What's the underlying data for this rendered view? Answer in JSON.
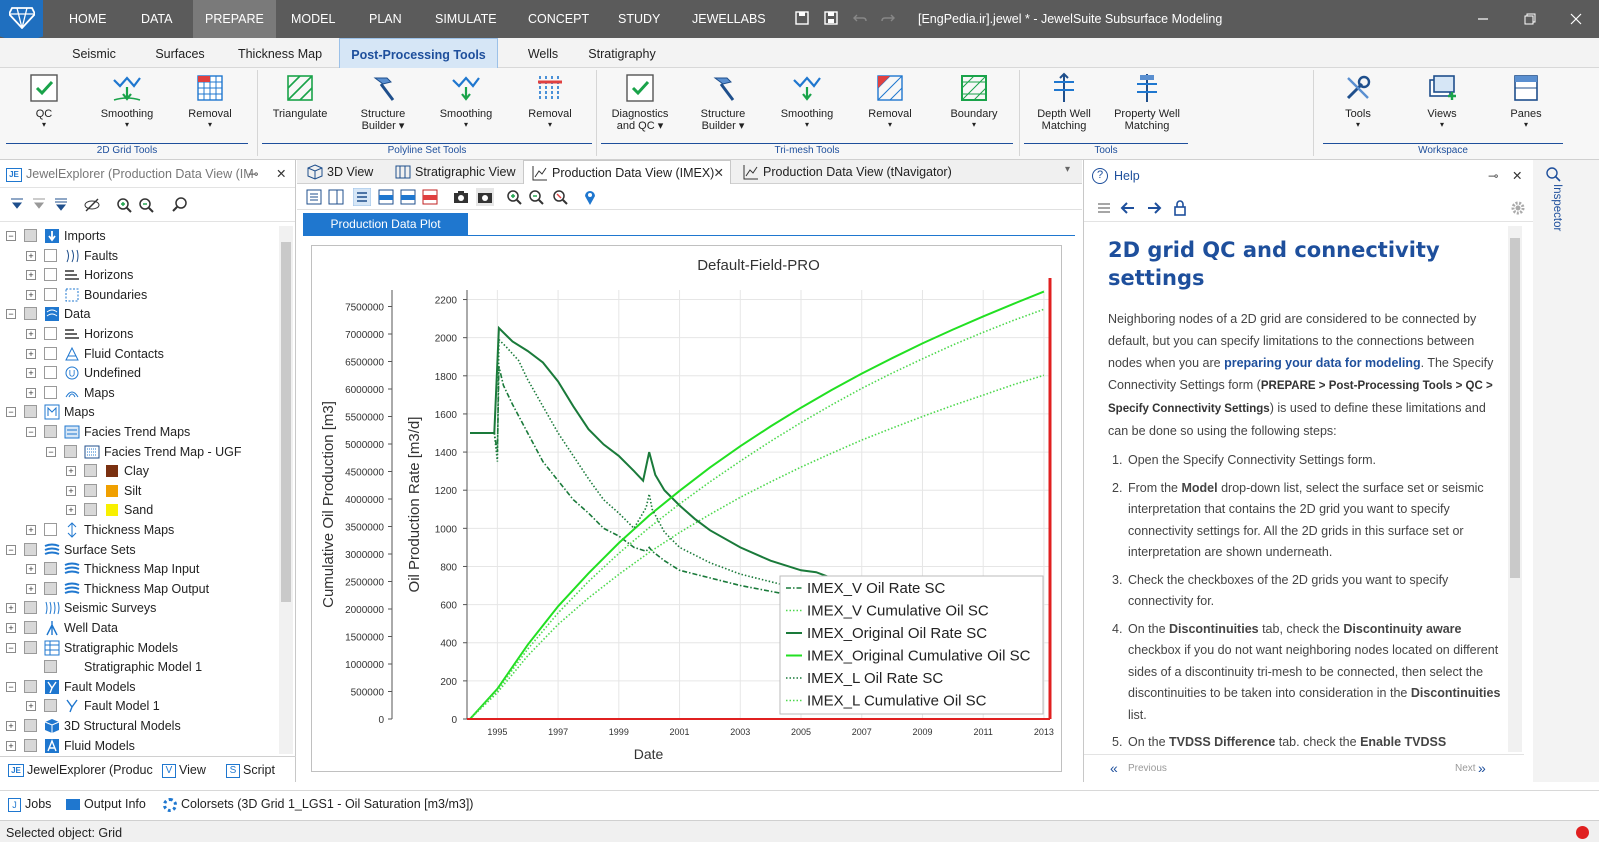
{
  "app": {
    "menu": [
      "HOME",
      "DATA",
      "PREPARE",
      "MODEL",
      "PLAN",
      "SIMULATE",
      "CONCEPT",
      "STUDY",
      "JEWELLABS"
    ],
    "active_menu": "PREPARE",
    "title_file": "[EngPedia.ir].jewel *",
    "title_app": " - JewelSuite Subsurface Modeling",
    "accent": "#1f77cf"
  },
  "subtabs": [
    "Seismic",
    "Surfaces",
    "Thickness Map",
    "Post-Processing Tools",
    "Wells",
    "Stratigraphy"
  ],
  "ribbon": {
    "b1": "QC",
    "b2": "Smoothing",
    "b3": "Removal",
    "g1": "2D Grid Tools",
    "b4": "Triangulate",
    "b5a": "Structure",
    "b5b": "Builder",
    "b6": "Smoothing",
    "b7": "Removal",
    "g2": "Polyline Set Tools",
    "b8a": "Diagnostics",
    "b8b": "and QC",
    "b9a": "Structure",
    "b9b": "Builder",
    "b10": "Smoothing",
    "b11": "Removal",
    "b12": "Boundary",
    "g3": "Tri-mesh Tools",
    "b13a": "Depth Well",
    "b13b": "Matching",
    "b14a": "Property Well",
    "b14b": "Matching",
    "g4": "Tools",
    "b15": "Tools",
    "b16": "Views",
    "b17": "Panes",
    "g5": "Workspace"
  },
  "explorer": {
    "title": "JewelExplorer (Production Data View (IM",
    "tree": [
      "Imports",
      "Faults",
      "Horizons",
      "Boundaries",
      "Data",
      "Horizons",
      "Fluid Contacts",
      "Undefined",
      "Maps",
      "Maps",
      "Facies Trend Maps",
      "Facies Trend Map - UGF",
      "Clay",
      "Silt",
      "Sand",
      "Thickness Maps",
      "Surface Sets",
      "Thickness Map Input",
      "Thickness Map Output",
      "Seismic Surveys",
      "Well Data",
      "Stratigraphic Models",
      "Stratigraphic Model 1",
      "Fault Models",
      "Fault Model 1",
      "3D Structural Models",
      "Fluid Models"
    ],
    "bottom_tabs": [
      "JewelExplorer (Produc",
      "View",
      "Script"
    ],
    "legend_colors": {
      "clay": "#7a3010",
      "silt": "#f0a000",
      "sand": "#f8f000"
    }
  },
  "center": {
    "tabs": [
      "3D View",
      "Stratigraphic View",
      "Production Data View (IMEX)",
      "Production Data View (tNavigator)"
    ],
    "plot_tab": "Production Data Plot"
  },
  "chart_data": {
    "type": "line",
    "title": "Default-Field-PRO",
    "xlabel": "Date",
    "ylabel_left": "Cumulative Oil Production [m3]",
    "ylabel_right": "Oil Production Rate [m3/d]",
    "x_ticks": [
      "1995",
      "1997",
      "1999",
      "2001",
      "2003",
      "2005",
      "2007",
      "2009",
      "2011",
      "2013"
    ],
    "xlim": [
      1994,
      2013.2
    ],
    "ylim_cum": [
      0,
      7800000
    ],
    "ylim_rate": [
      0,
      2250
    ],
    "cum_ticks": [
      "7500000",
      "7000000",
      "6500000",
      "6000000",
      "5500000",
      "5000000",
      "4500000",
      "4000000",
      "3500000",
      "3000000",
      "2500000",
      "2000000",
      "1500000",
      "1000000",
      "500000",
      "0"
    ],
    "rate_ticks": [
      "2200",
      "2000",
      "1800",
      "1600",
      "1400",
      "1200",
      "1000",
      "800",
      "600",
      "400",
      "200",
      "0"
    ],
    "legend_placement": "bottom-right",
    "series": [
      {
        "name": "IMEX_V Oil Rate SC",
        "axis": "rate",
        "color": "#1a7a3a",
        "style": "dashdot",
        "x": [
          1994.1,
          1994.9,
          1995.0,
          1995.05,
          1995.2,
          1995.5,
          1996,
          1996.5,
          1997,
          1997.5,
          1998,
          1998.5,
          1999,
          1999.5,
          1999.9,
          2000,
          2000.1,
          2000.5,
          2001,
          2002,
          2003,
          2004,
          2005,
          2006
        ],
        "y": [
          1500,
          1500,
          1400,
          1850,
          1750,
          1650,
          1500,
          1350,
          1250,
          1150,
          1080,
          1000,
          960,
          900,
          880,
          900,
          880,
          830,
          780,
          740,
          700,
          670,
          640,
          620
        ]
      },
      {
        "name": "IMEX_V Cumulative Oil SC",
        "axis": "cum",
        "color": "#4cd84c",
        "style": "dotted",
        "x": [
          1994.1,
          1995,
          1996,
          1997,
          1998,
          1999,
          2000,
          2001,
          2002,
          2003,
          2004,
          2005,
          2006,
          2007,
          2008,
          2009,
          2010,
          2011,
          2012,
          2013
        ],
        "y": [
          0,
          480000,
          1150000,
          1720000,
          2200000,
          2630000,
          3030000,
          3390000,
          3720000,
          4030000,
          4310000,
          4580000,
          4830000,
          5070000,
          5290000,
          5500000,
          5700000,
          5890000,
          6080000,
          6250000
        ]
      },
      {
        "name": "IMEX_Original Oil Rate SC",
        "axis": "rate",
        "color": "#1a7a3a",
        "style": "solid",
        "x": [
          1994.1,
          1994.9,
          1995.05,
          1995.5,
          1996,
          1996.5,
          1997,
          1997.5,
          1998,
          1998.5,
          1999,
          1999.5,
          1999.8,
          2000,
          2000.2,
          2000.5,
          2001,
          2001.5,
          2002,
          2003,
          2004,
          2005,
          2005.5,
          2006
        ],
        "y": [
          1500,
          1500,
          2050,
          1980,
          1930,
          1870,
          1770,
          1640,
          1520,
          1440,
          1380,
          1300,
          1250,
          1400,
          1280,
          1200,
          1120,
          1050,
          990,
          900,
          830,
          780,
          770,
          740
        ]
      },
      {
        "name": "IMEX_Original Cumulative Oil SC",
        "axis": "cum",
        "color": "#22e022",
        "style": "solid",
        "x": [
          1994.1,
          1995,
          1996,
          1997,
          1998,
          1999,
          2000,
          2001,
          2002,
          2003,
          2004,
          2005,
          2006,
          2007,
          2008,
          2009,
          2010,
          2011,
          2012,
          2013
        ],
        "y": [
          0,
          550000,
          1350000,
          2050000,
          2650000,
          3200000,
          3700000,
          4150000,
          4570000,
          4960000,
          5320000,
          5660000,
          5980000,
          6280000,
          6560000,
          6830000,
          7080000,
          7320000,
          7550000,
          7770000
        ]
      },
      {
        "name": "IMEX_L Oil Rate SC",
        "axis": "rate",
        "color": "#1a7a3a",
        "style": "dotted",
        "x": [
          1994.1,
          1994.9,
          1995.0,
          1995.05,
          1995.3,
          1995.7,
          1996,
          1996.5,
          1997,
          1997.5,
          1998,
          1998.5,
          1999,
          1999.5,
          1999.9,
          2000,
          2000.1,
          2000.5,
          2001,
          2002,
          2003,
          2004,
          2005,
          2006
        ],
        "y": [
          1500,
          1500,
          1350,
          1990,
          1950,
          1880,
          1780,
          1640,
          1500,
          1380,
          1260,
          1150,
          1080,
          1000,
          1110,
          1180,
          1100,
          980,
          900,
          820,
          760,
          720,
          680,
          650
        ]
      },
      {
        "name": "IMEX_L Cumulative Oil SC",
        "axis": "cum",
        "color": "#4cd84c",
        "style": "dotted",
        "x": [
          1994.1,
          1995,
          1996,
          1997,
          1998,
          1999,
          2000,
          2001,
          2002,
          2003,
          2004,
          2005,
          2006,
          2007,
          2008,
          2009,
          2010,
          2011,
          2012,
          2013
        ],
        "y": [
          0,
          520000,
          1270000,
          1930000,
          2500000,
          3010000,
          3480000,
          3910000,
          4310000,
          4690000,
          5050000,
          5390000,
          5710000,
          6010000,
          6290000,
          6550000,
          6800000,
          7030000,
          7250000,
          7450000
        ]
      }
    ]
  },
  "help": {
    "header": "Help",
    "title": "2D grid QC and connectivity settings",
    "p1a": "Neighboring nodes of a 2D grid are considered to be connected by default, but you can specify limitations to the connections between nodes when you are ",
    "p1link": "preparing your data for modeling",
    "p1b": ". The Specify Connectivity Settings form (",
    "p1path": "PREPARE > Post-Processing Tools > QC > Specify Connectivity Settings",
    "p1c": ") is used to define these limitations and can be done so using the following steps:",
    "s1": "Open the Specify Connectivity Settings form.",
    "s2a": "From the ",
    "s2b": "Model",
    "s2c": " drop-down list, select the surface set or seismic interpretation that contains the 2D grid you want to specify connectivity settings for. All the 2D grids in this surface set or interpretation are shown underneath.",
    "s3": "Check the checkboxes of the 2D grids you want to specify connectivity for.",
    "s4a": "On the ",
    "s4b": "Discontinuities",
    "s4c": " tab, check the ",
    "s4d": "Discontinuity aware",
    "s4e": " checkbox if you do not want neighboring nodes located on different sides of a discontinuity tri-mesh to be connected, then select the discontinuities to be taken into consideration in the ",
    "s4f": "Discontinuities",
    "s4g": " list.",
    "s5a": "On the ",
    "s5b": "TVDSS Difference",
    "s5c": " tab, check the ",
    "s5d": "Enable TVDSS difference",
    "prev": "Previous",
    "next": "Next",
    "inspector": "Inspector"
  },
  "bottom": {
    "jobs": "Jobs",
    "output": "Output Info",
    "colorsets": "Colorsets (3D Grid 1_LGS1 - Oil Saturation [m3/m3])"
  },
  "status": "Selected object: Grid"
}
